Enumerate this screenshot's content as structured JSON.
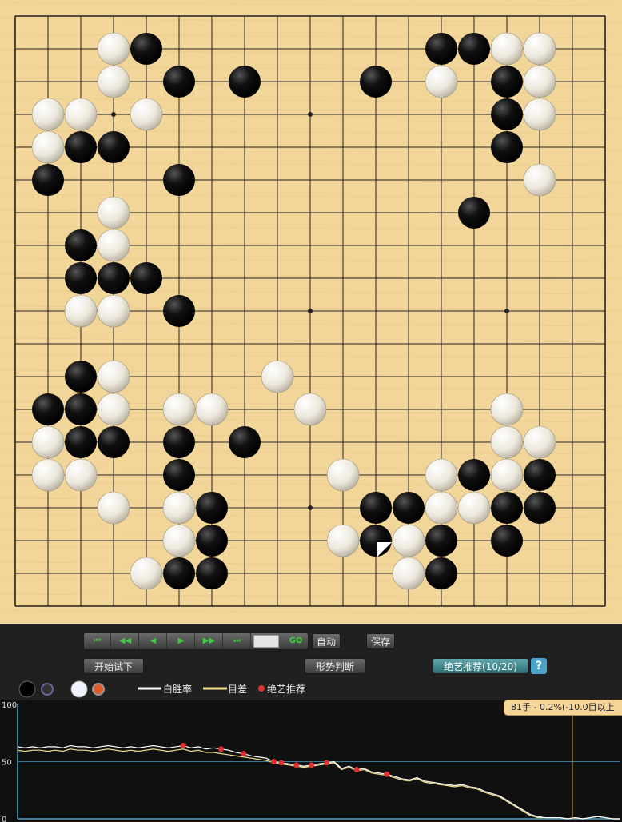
{
  "board": {
    "size": 18,
    "black": [
      [
        4,
        1
      ],
      [
        13,
        1
      ],
      [
        14,
        1
      ],
      [
        5,
        2
      ],
      [
        7,
        2
      ],
      [
        11,
        2
      ],
      [
        15,
        2
      ],
      [
        15,
        3
      ],
      [
        2,
        4
      ],
      [
        3,
        4
      ],
      [
        15,
        4
      ],
      [
        1,
        5
      ],
      [
        5,
        5
      ],
      [
        14,
        6
      ],
      [
        2,
        7
      ],
      [
        2,
        8
      ],
      [
        3,
        8
      ],
      [
        4,
        8
      ],
      [
        5,
        9
      ],
      [
        2,
        11
      ],
      [
        1,
        12
      ],
      [
        2,
        12
      ],
      [
        2,
        13
      ],
      [
        3,
        13
      ],
      [
        5,
        13
      ],
      [
        7,
        13
      ],
      [
        5,
        14
      ],
      [
        14,
        14
      ],
      [
        16,
        14
      ],
      [
        6,
        15
      ],
      [
        11,
        15
      ],
      [
        12,
        15
      ],
      [
        15,
        15
      ],
      [
        16,
        15
      ],
      [
        6,
        16
      ],
      [
        11,
        16
      ],
      [
        13,
        16
      ],
      [
        15,
        16
      ],
      [
        5,
        17
      ],
      [
        6,
        17
      ],
      [
        13,
        17
      ]
    ],
    "white": [
      [
        3,
        1
      ],
      [
        15,
        1
      ],
      [
        16,
        1
      ],
      [
        3,
        2
      ],
      [
        13,
        2
      ],
      [
        16,
        2
      ],
      [
        1,
        3
      ],
      [
        2,
        3
      ],
      [
        4,
        3
      ],
      [
        16,
        3
      ],
      [
        1,
        4
      ],
      [
        16,
        5
      ],
      [
        3,
        6
      ],
      [
        3,
        7
      ],
      [
        2,
        9
      ],
      [
        3,
        9
      ],
      [
        3,
        11
      ],
      [
        8,
        11
      ],
      [
        3,
        12
      ],
      [
        5,
        12
      ],
      [
        6,
        12
      ],
      [
        9,
        12
      ],
      [
        15,
        12
      ],
      [
        1,
        13
      ],
      [
        15,
        13
      ],
      [
        16,
        13
      ],
      [
        1,
        14
      ],
      [
        2,
        14
      ],
      [
        10,
        14
      ],
      [
        13,
        14
      ],
      [
        15,
        14
      ],
      [
        3,
        15
      ],
      [
        5,
        15
      ],
      [
        13,
        15
      ],
      [
        14,
        15
      ],
      [
        5,
        16
      ],
      [
        10,
        16
      ],
      [
        12,
        16
      ],
      [
        4,
        17
      ],
      [
        12,
        17
      ]
    ],
    "last_move": [
      11,
      16
    ],
    "star_points": [
      [
        3,
        3
      ],
      [
        9,
        3
      ],
      [
        3,
        9
      ],
      [
        9,
        9
      ],
      [
        15,
        9
      ],
      [
        3,
        15
      ],
      [
        9,
        15
      ]
    ]
  },
  "nav": {
    "first": "⏮",
    "prev10": "◀◀",
    "prev": "◀",
    "next": "▶",
    "next10": "▶▶",
    "last": "⏭",
    "go": "GO",
    "move_value": ""
  },
  "buttons": {
    "auto": "自动",
    "save": "保存",
    "try": "开始试下",
    "judge": "形势判断",
    "recommend": "绝艺推荐(10/20)",
    "help": "?"
  },
  "legend": {
    "win_rate": "白胜率",
    "score_diff": "目差",
    "recommend": "绝艺推荐"
  },
  "graph": {
    "y_labels": [
      "100",
      "50",
      "0"
    ],
    "tooltip": "81手 - 0.2%(-10.0目以上",
    "colors": {
      "win_rate": "#ffffff",
      "score_diff": "#f3e08a",
      "recommend": "#e03030",
      "guide": "#e0a040",
      "axis": "#4aa3c9"
    },
    "total_moves": 81,
    "win_rate": [
      63,
      62,
      63,
      62,
      63,
      63,
      62,
      64,
      63,
      63,
      62,
      63,
      64,
      63,
      62,
      63,
      62,
      63,
      64,
      63,
      62,
      63,
      64,
      62,
      63,
      61,
      62,
      61,
      60,
      58,
      57,
      55,
      54,
      53,
      50,
      49,
      48,
      47,
      46,
      47,
      48,
      49,
      50,
      44,
      46,
      43,
      44,
      41,
      40,
      39,
      37,
      35,
      34,
      36,
      33,
      32,
      31,
      30,
      29,
      30,
      28,
      27,
      24,
      22,
      20,
      16,
      12,
      8,
      4,
      2,
      1,
      1,
      1,
      0,
      1,
      0,
      1,
      2,
      1,
      0,
      0
    ],
    "score_diff": [
      60,
      59,
      60,
      60,
      59,
      60,
      59,
      61,
      60,
      60,
      59,
      60,
      61,
      60,
      59,
      60,
      59,
      60,
      61,
      60,
      59,
      60,
      61,
      59,
      60,
      58,
      58,
      57,
      56,
      55,
      54,
      53,
      52,
      51,
      49,
      48,
      47,
      46,
      45,
      46,
      47,
      48,
      49,
      43,
      45,
      42,
      43,
      40,
      39,
      38,
      36,
      34,
      33,
      35,
      32,
      31,
      30,
      29,
      28,
      29,
      27,
      26,
      23,
      21,
      19,
      15,
      11,
      7,
      3,
      1,
      1,
      1,
      1,
      0,
      1,
      0,
      1,
      2,
      1,
      0,
      0
    ],
    "recommend_moves": [
      22,
      27,
      30,
      34,
      35,
      37,
      39,
      41,
      45,
      49
    ]
  }
}
